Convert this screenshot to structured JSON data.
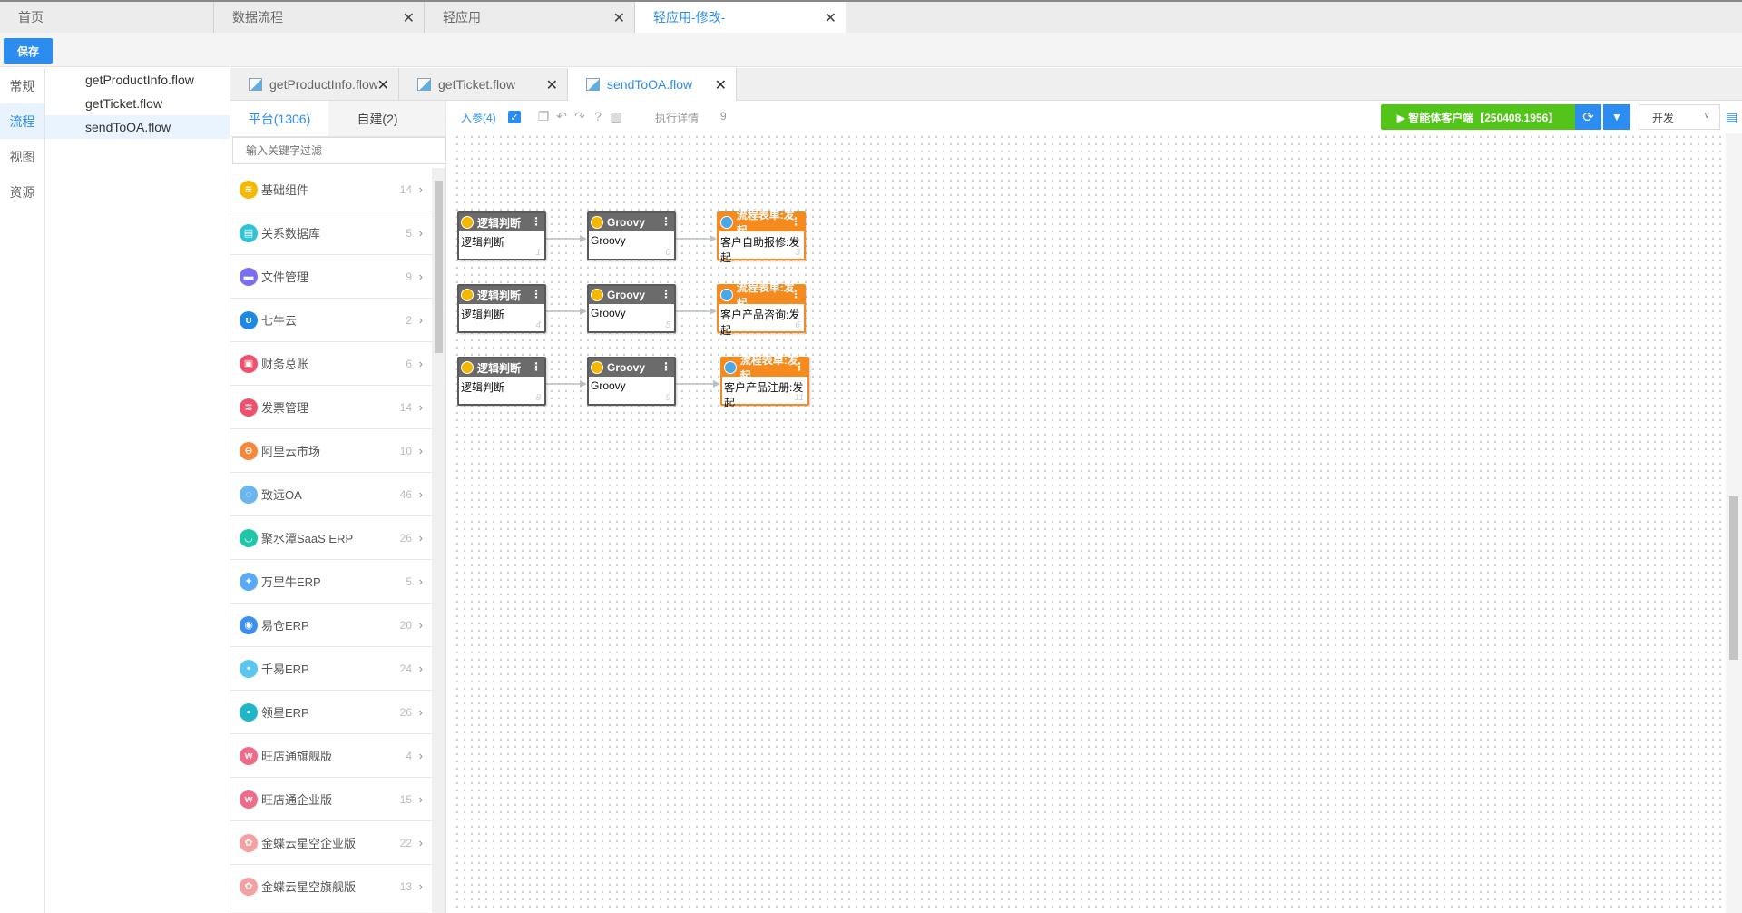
{
  "top_tabs": [
    {
      "label": "首页",
      "closable": false,
      "active": false
    },
    {
      "label": "数据流程",
      "closable": true,
      "active": false
    },
    {
      "label": "轻应用",
      "closable": true,
      "active": false
    },
    {
      "label": "轻应用-修改-",
      "closable": true,
      "active": true
    }
  ],
  "toolbar": {
    "save_label": "保存"
  },
  "rail": [
    "常规",
    "流程",
    "视图",
    "资源"
  ],
  "rail_active": 1,
  "files": [
    "getProductInfo.flow",
    "getTicket.flow",
    "sendToOA.flow"
  ],
  "files_active": 2,
  "editor_tabs": [
    {
      "label": "getProductInfo.flow",
      "active": false
    },
    {
      "label": "getTicket.flow",
      "active": false
    },
    {
      "label": "sendToOA.flow",
      "active": true
    }
  ],
  "component_panel": {
    "tabs": [
      "平台(1306)",
      "自建(2)"
    ],
    "search_placeholder": "输入关键字过滤",
    "items": [
      {
        "name": "基础组件",
        "count": "14",
        "color": "#f5b700",
        "glyph": "≋"
      },
      {
        "name": "关系数据库",
        "count": "5",
        "color": "#2ec4d6",
        "glyph": "▤"
      },
      {
        "name": "文件管理",
        "count": "9",
        "color": "#7b6ff0",
        "glyph": "▬"
      },
      {
        "name": "七牛云",
        "count": "2",
        "color": "#1e88e5",
        "glyph": "ʊ"
      },
      {
        "name": "财务总账",
        "count": "6",
        "color": "#f0506e",
        "glyph": "▣"
      },
      {
        "name": "发票管理",
        "count": "14",
        "color": "#f0506e",
        "glyph": "≋"
      },
      {
        "name": "阿里云市场",
        "count": "10",
        "color": "#f5873b",
        "glyph": "⊖"
      },
      {
        "name": "致远OA",
        "count": "46",
        "color": "#6ab7f0",
        "glyph": "◌"
      },
      {
        "name": "聚水潭SaaS ERP",
        "count": "26",
        "color": "#1fc7a8",
        "glyph": "◡"
      },
      {
        "name": "万里牛ERP",
        "count": "5",
        "color": "#5aa9f5",
        "glyph": "✦"
      },
      {
        "name": "易仓ERP",
        "count": "20",
        "color": "#3b8ff0",
        "glyph": "◉"
      },
      {
        "name": "千易ERP",
        "count": "24",
        "color": "#5bc7f0",
        "glyph": "•"
      },
      {
        "name": "领星ERP",
        "count": "26",
        "color": "#1fb6c9",
        "glyph": "▪"
      },
      {
        "name": "旺店通旗舰版",
        "count": "4",
        "color": "#f06a8a",
        "glyph": "w"
      },
      {
        "name": "旺店通企业版",
        "count": "15",
        "color": "#f06a8a",
        "glyph": "w"
      },
      {
        "name": "金蝶云星空企业版",
        "count": "22",
        "color": "#f5a0a0",
        "glyph": "✿"
      },
      {
        "name": "金蝶云星空旗舰版",
        "count": "13",
        "color": "#f5a0a0",
        "glyph": "✿"
      }
    ]
  },
  "canvas_toolbar": {
    "params_label": "入参(4)",
    "exec_label": "执行详情",
    "exec_count": "9",
    "agent_label": "▶ 智能体客户端【250408.1956】",
    "env_value": "开发"
  },
  "nodes": [
    {
      "title": "逻辑判断",
      "body": "逻辑判断",
      "num": "1",
      "type": "gray"
    },
    {
      "title": "Groovy",
      "body": "Groovy",
      "num": "0",
      "type": "gray"
    },
    {
      "title": "流程表单:发起",
      "body": "客户自助报修:发起",
      "num": "3",
      "type": "orange"
    },
    {
      "title": "逻辑判断",
      "body": "逻辑判断",
      "num": "4",
      "type": "gray"
    },
    {
      "title": "Groovy",
      "body": "Groovy",
      "num": "5",
      "type": "gray"
    },
    {
      "title": "流程表单:发起",
      "body": "客户产品咨询:发起",
      "num": "6",
      "type": "orange"
    },
    {
      "title": "逻辑判断",
      "body": "逻辑判断",
      "num": "8",
      "type": "gray"
    },
    {
      "title": "Groovy",
      "body": "Groovy",
      "num": "9",
      "type": "gray"
    },
    {
      "title": "流程表单:发起",
      "body": "客户产品注册:发起",
      "num": "11",
      "type": "orange"
    }
  ],
  "colors": {
    "accent": "#2d8cf0",
    "green": "#52c41a",
    "orange": "#f58b1f",
    "node_gray": "#6b6b6b"
  }
}
